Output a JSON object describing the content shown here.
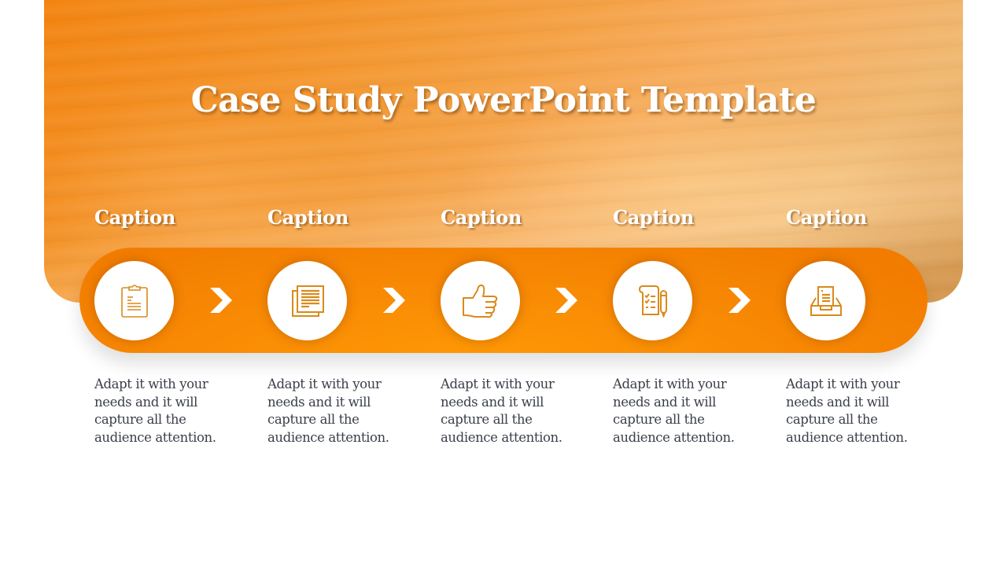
{
  "slide": {
    "title": "Case Study PowerPoint Template",
    "accent_color": "#F88A04",
    "icon_color": "#D98A1A"
  },
  "steps": [
    {
      "caption": "Caption",
      "icon": "clipboard-icon",
      "description": "Adapt it with your needs and it will capture all the audience attention."
    },
    {
      "caption": "Caption",
      "icon": "documents-icon",
      "description": "Adapt it with your needs and it will capture all the audience attention."
    },
    {
      "caption": "Caption",
      "icon": "thumbs-up-icon",
      "description": "Adapt it with your needs and it will capture all the audience attention."
    },
    {
      "caption": "Caption",
      "icon": "checklist-pen-icon",
      "description": "Adapt it with your needs and it will capture all the audience attention."
    },
    {
      "caption": "Caption",
      "icon": "inbox-tray-icon",
      "description": "Adapt it with your needs and it will capture all the audience attention."
    }
  ],
  "connectors": [
    "chevron-right-icon",
    "chevron-right-icon",
    "chevron-right-icon",
    "chevron-right-icon"
  ]
}
